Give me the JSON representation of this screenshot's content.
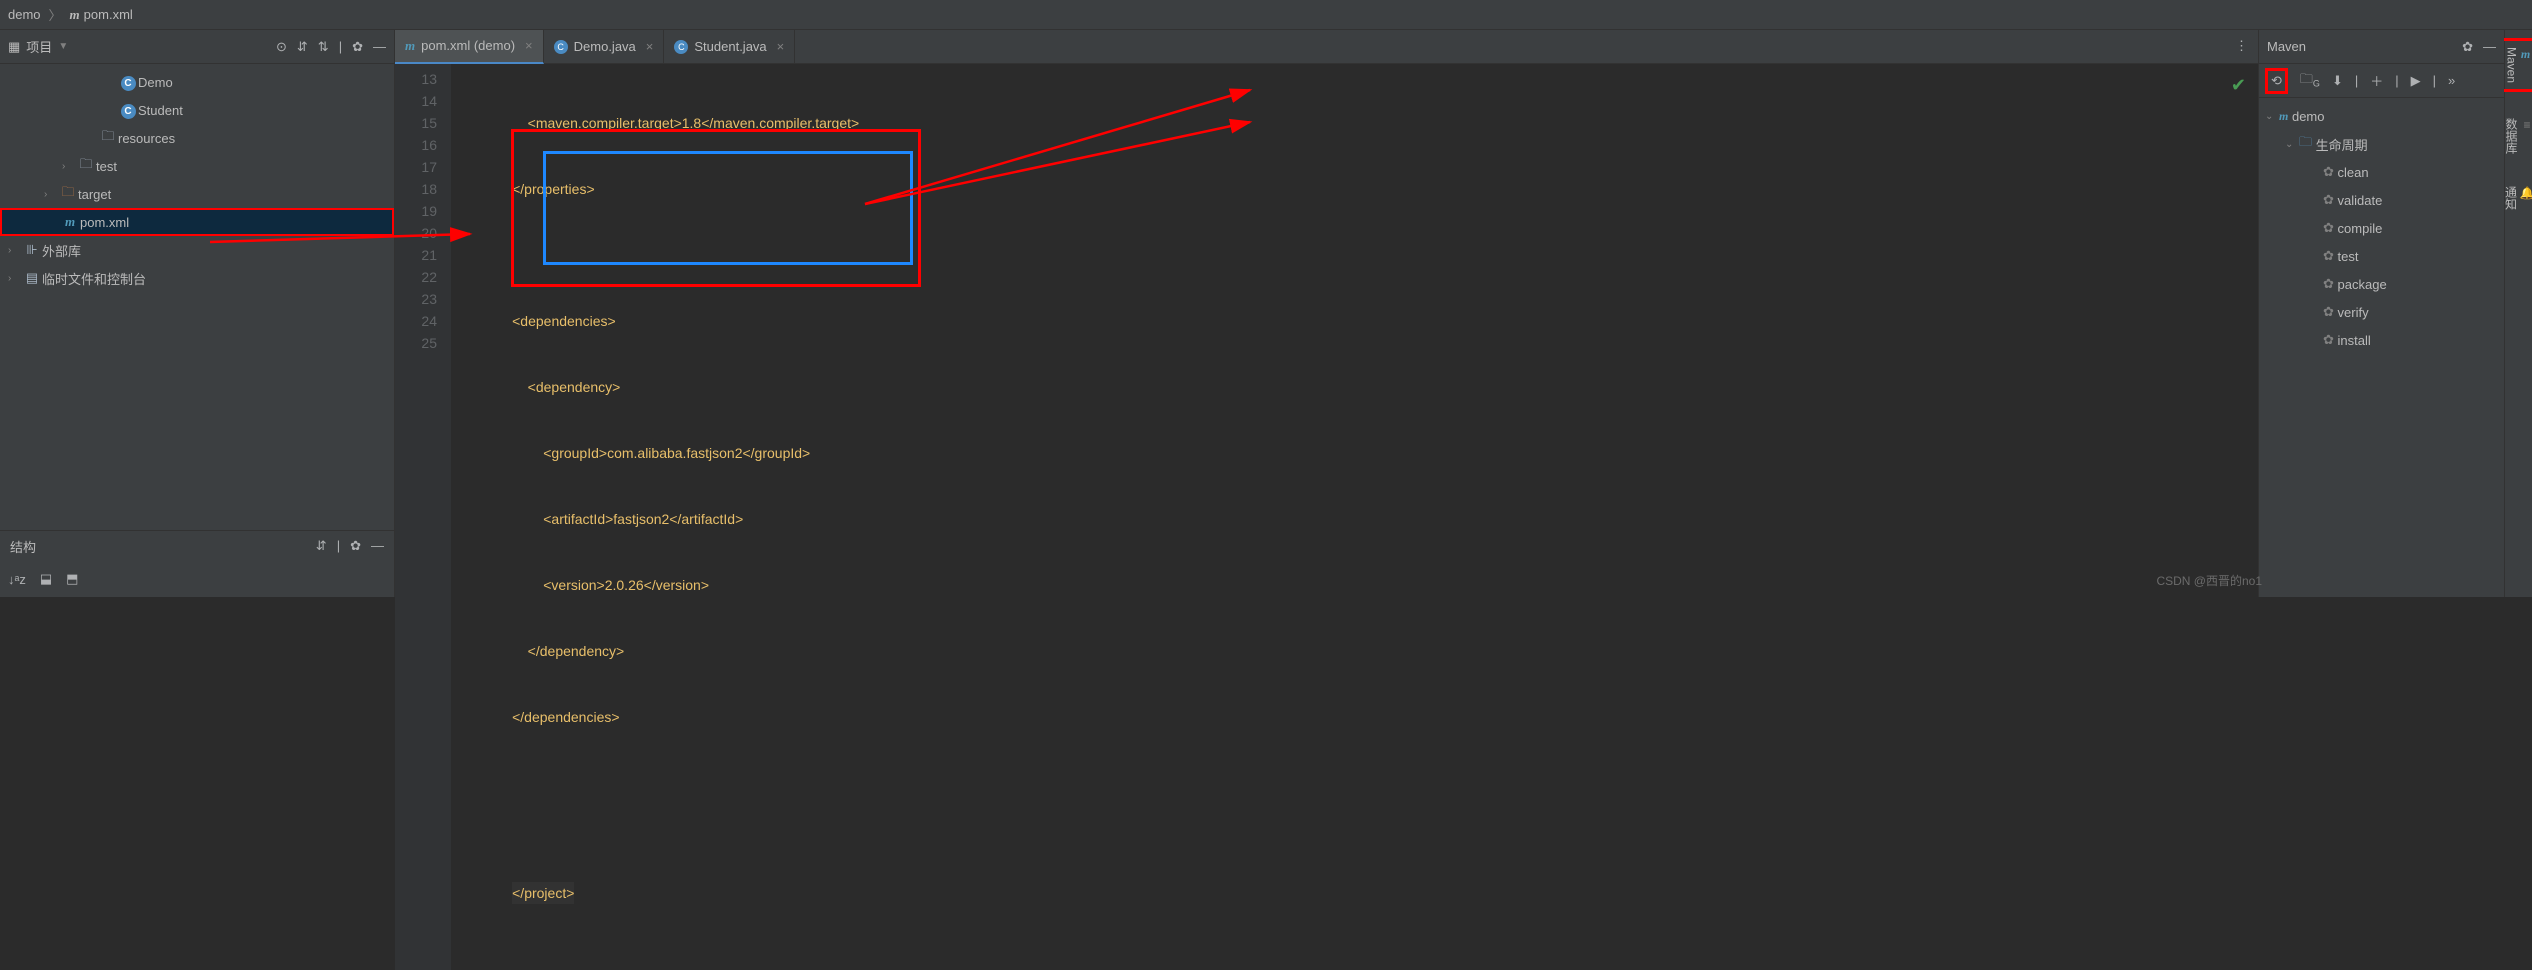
{
  "breadcrumb": {
    "project": "demo",
    "file": "pom.xml"
  },
  "left": {
    "title": "项目",
    "tree": {
      "demo": "Demo",
      "student": "Student",
      "resources": "resources",
      "test": "test",
      "target": "target",
      "pom": "pom.xml",
      "ext": "外部库",
      "scratch": "临时文件和控制台"
    },
    "struct": "结构"
  },
  "tabs": {
    "pom": "pom.xml (demo)",
    "demo": "Demo.java",
    "student": "Student.java"
  },
  "code": {
    "l13": "            <maven.compiler.target>1.8</maven.compiler.target>",
    "l14": "        </properties>",
    "l15": "",
    "l16": "        <dependencies>",
    "l17": "            <dependency>",
    "l18": "                <groupId>com.alibaba.fastjson2</groupId>",
    "l19": "                <artifactId>fastjson2</artifactId>",
    "l20": "                <version>2.0.26</version>",
    "l21": "            </dependency>",
    "l22": "        </dependencies>",
    "l23": "",
    "l24": "",
    "l25": "</project>"
  },
  "gutter": [
    "13",
    "14",
    "15",
    "16",
    "17",
    "18",
    "19",
    "20",
    "21",
    "22",
    "23",
    "24",
    "25"
  ],
  "maven": {
    "title": "Maven",
    "project": "demo",
    "lifecycle": "生命周期",
    "goals": [
      "clean",
      "validate",
      "compile",
      "test",
      "package",
      "verify",
      "install"
    ]
  },
  "rbar": {
    "maven": "Maven",
    "db": "数据库",
    "notify": "通知"
  },
  "watermark": "CSDN @西晋的no1"
}
